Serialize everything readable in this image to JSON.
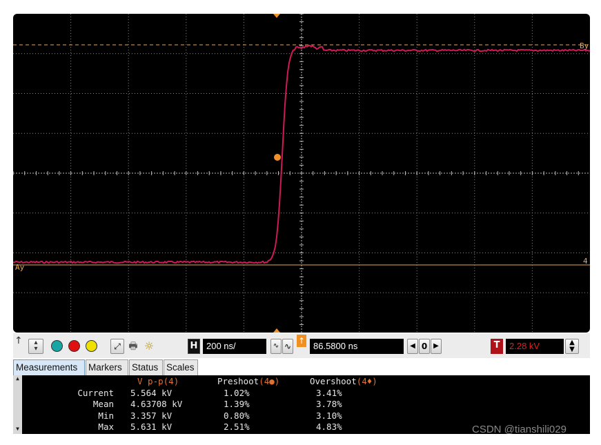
{
  "markers": {
    "a_label": "Ay",
    "b_label": "By",
    "channel_label": "4"
  },
  "trace": {
    "color": "#d01a55",
    "marker_color": "#f0902a",
    "grid_color": "#8a8a8a"
  },
  "toolbar": {
    "color_dots": [
      "#1aa5a5",
      "#e01010",
      "#f0e000"
    ],
    "h_label": "H",
    "timebase": "200 ns/",
    "delay": "86.5800 ns",
    "delay_ref": "0",
    "t_label": "T",
    "trigger_level": "2.28 kV"
  },
  "tabs": [
    "Measurements",
    "Markers",
    "Status",
    "Scales"
  ],
  "measurements": {
    "columns": [
      {
        "name": "V p-p",
        "source": "(4)"
      },
      {
        "name": "Preshoot",
        "source": "(4●)"
      },
      {
        "name": "Overshoot",
        "source": "(4♦)"
      }
    ],
    "rows": [
      {
        "label": "Current",
        "values": [
          "5.564 kV",
          "1.02%",
          "3.41%"
        ]
      },
      {
        "label": "Mean",
        "values": [
          "4.63708 kV",
          "1.39%",
          "3.78%"
        ]
      },
      {
        "label": "Min",
        "values": [
          "3.357 kV",
          "0.80%",
          "3.10%"
        ]
      },
      {
        "label": "Max",
        "values": [
          "5.631 kV",
          "2.51%",
          "4.83%"
        ]
      }
    ]
  },
  "watermark": "CSDN @tianshili029"
}
